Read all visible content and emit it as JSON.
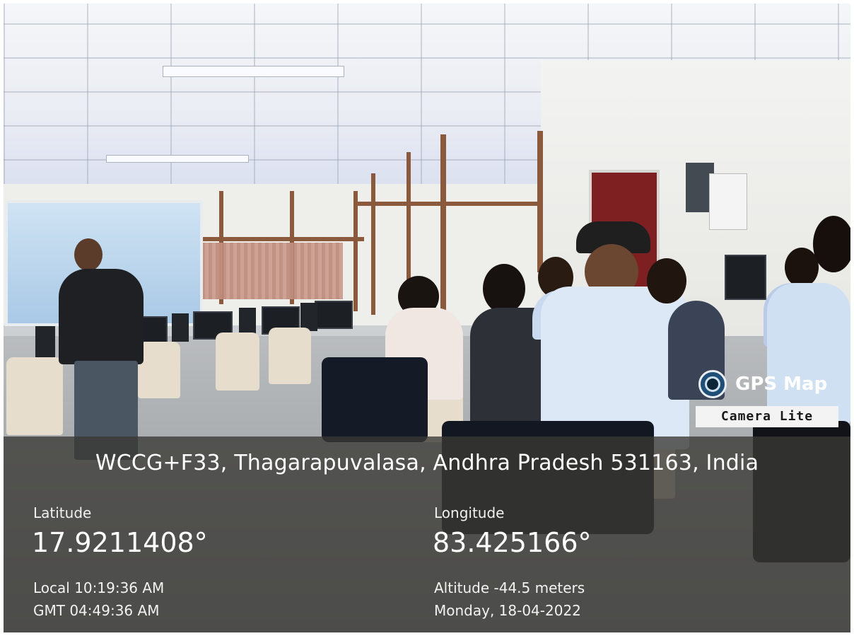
{
  "watermark": {
    "app_name": "GPS Map",
    "app_subtitle": "Camera Lite",
    "icon": "camera-icon"
  },
  "location": {
    "address": "WCCG+F33, Thagarapuvalasa, Andhra Pradesh 531163, India",
    "latitude_label": "Latitude",
    "latitude": "17.9211408°",
    "longitude_label": "Longitude",
    "longitude": "83.425166°",
    "local_time": "Local 10:19:36 AM",
    "gmt_time": "GMT 04:49:36 AM",
    "altitude": "Altitude -44.5 meters",
    "date": "Monday, 18-04-2022"
  },
  "colors": {
    "overlay": "#3a3834",
    "text": "#ffffff",
    "door": "#7e1f22"
  }
}
